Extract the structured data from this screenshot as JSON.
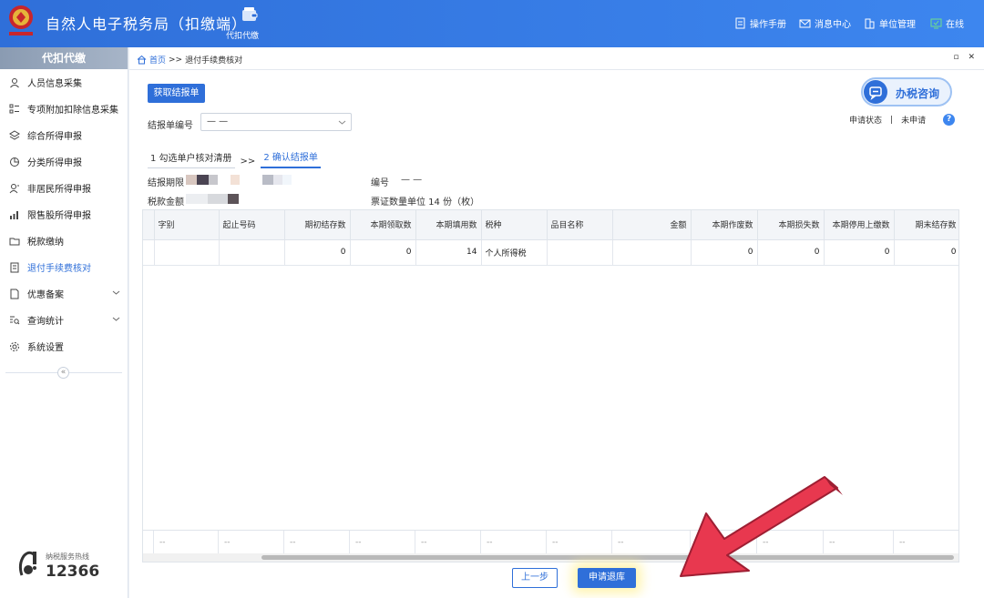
{
  "header": {
    "title": "自然人电子税务局（扣缴端）",
    "module_label": "代扣代缴",
    "menu": {
      "manual": "操作手册",
      "messages": "消息中心",
      "unit": "单位管理",
      "online": "在线"
    }
  },
  "sidebar": {
    "heading": "代扣代缴",
    "items": [
      {
        "label": "人员信息采集"
      },
      {
        "label": "专项附加扣除信息采集"
      },
      {
        "label": "综合所得申报"
      },
      {
        "label": "分类所得申报"
      },
      {
        "label": "非居民所得申报"
      },
      {
        "label": "限售股所得申报"
      },
      {
        "label": "税款缴纳"
      },
      {
        "label": "退付手续费核对"
      },
      {
        "label": "优惠备案"
      },
      {
        "label": "查询统计"
      },
      {
        "label": "系统设置"
      }
    ],
    "active_item": "退付手续费核对",
    "collapse_glyph": "«",
    "hotline_label": "纳税服务热线",
    "hotline_number": "12366"
  },
  "breadcrumb": {
    "home": "首页",
    "separator": ">>",
    "current": "退付手续费核对"
  },
  "toolbar": {
    "fetch_label": "获取结报单",
    "consult_label": "办税咨询"
  },
  "status": {
    "label": "申请状态",
    "separator": "|",
    "value": "未申请"
  },
  "form": {
    "report_no_label": "结报单编号",
    "report_no_value": "— —"
  },
  "steps": {
    "step1": "1 勾选单户核对清册",
    "separator": ">>",
    "step2": "2 确认结报单"
  },
  "info": {
    "period_label": "结报期限",
    "number_label": "编号",
    "number_value": "— —",
    "tax_amount_label": "税款金额",
    "ticket_text": "票证数量单位  14 份（枚）"
  },
  "table": {
    "headers": [
      "字别",
      "起止号码",
      "期初结存数",
      "本期领取数",
      "本期填用数",
      "税种",
      "品目名称",
      "金额",
      "本期作废数",
      "本期损失数",
      "本期停用上缴数",
      "期末结存数"
    ],
    "rows": [
      {
        "c0": "",
        "c1": "",
        "c2": "0",
        "c3": "0",
        "c4": "14",
        "c5": "个人所得税",
        "c6": "",
        "c7": "",
        "c8": "0",
        "c9": "0",
        "c10": "0",
        "c11": "0"
      }
    ],
    "footer_placeholder": "--"
  },
  "actions": {
    "prev_label": "上一步",
    "return_label": "申请退库"
  },
  "colors": {
    "brand": "#2f6fd9",
    "arrow": "#e8384f"
  }
}
